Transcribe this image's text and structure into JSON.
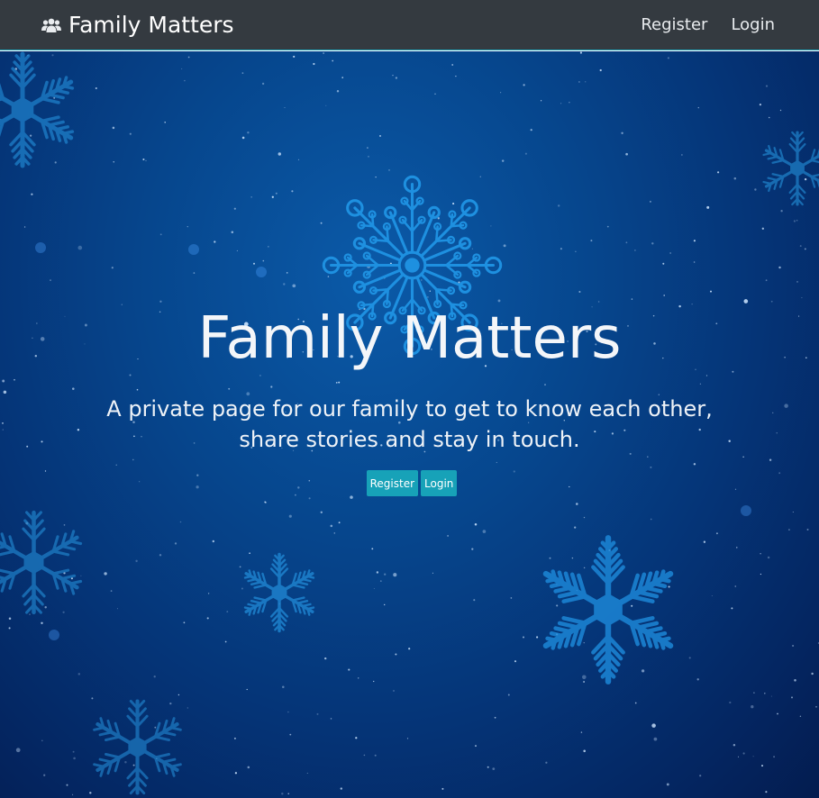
{
  "navbar": {
    "brand_icon": "users-icon",
    "brand_label": "Family Matters",
    "links": [
      {
        "label": "Register"
      },
      {
        "label": "Login"
      }
    ]
  },
  "hero": {
    "title": "Family Matters",
    "subtitle": "A private page for our family to get to know each other, share stories and stay in touch.",
    "buttons": [
      {
        "label": "Register"
      },
      {
        "label": "Login"
      }
    ],
    "background_icon": "snowflake-icon"
  },
  "colors": {
    "navbar_bg": "#343a40",
    "accent": "#17a2b8",
    "hero_bg": "#053578",
    "text": "#ffffff"
  }
}
